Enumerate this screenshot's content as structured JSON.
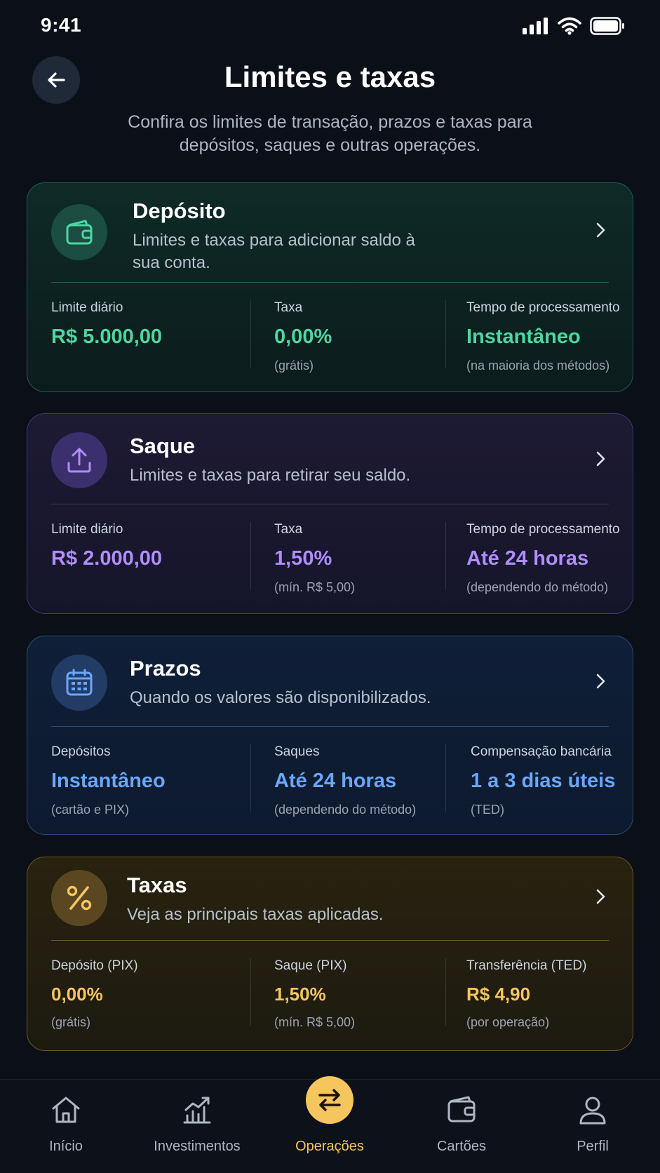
{
  "status_bar": {
    "time": "9:41"
  },
  "header": {
    "title": "Limites e taxas",
    "subtitle": "Confira os limites de transação, prazos e taxas para depósitos, saques e outras operações."
  },
  "colors": {
    "green": "#4ed6a0",
    "purple": "#b08cff",
    "blue": "#6aa6ff",
    "gold": "#f7c55d"
  },
  "cards": {
    "deposito": {
      "icon": "wallet-icon",
      "title": "Depósito",
      "description": "Limites e taxas para adicionar saldo à sua conta.",
      "stats": [
        {
          "label": "Limite diário",
          "value": "R$ 5.000,00",
          "note": ""
        },
        {
          "label": "Taxa",
          "value": "0,00%",
          "note": "(grátis)"
        },
        {
          "label": "Tempo de processamento",
          "value": "Instantâneo",
          "note": "(na maioria dos métodos)"
        }
      ]
    },
    "saque": {
      "icon": "upload-icon",
      "title": "Saque",
      "description": "Limites e taxas para retirar seu saldo.",
      "stats": [
        {
          "label": "Limite diário",
          "value": "R$ 2.000,00",
          "note": ""
        },
        {
          "label": "Taxa",
          "value": "1,50%",
          "note": "(mín. R$ 5,00)"
        },
        {
          "label": "Tempo de processamento",
          "value": "Até 24 horas",
          "note": "(dependendo do método)"
        }
      ]
    },
    "prazos": {
      "icon": "calendar-icon",
      "title": "Prazos",
      "description": "Quando os valores são disponibilizados.",
      "stats": [
        {
          "label": "Depósitos",
          "value": "Instantâneo",
          "note": "(cartão e PIX)"
        },
        {
          "label": "Saques",
          "value": "Até 24 horas",
          "note": "(dependendo do método)"
        },
        {
          "label": "Compensação bancária",
          "value": "1 a 3 dias úteis",
          "note": "(TED)"
        }
      ]
    },
    "taxas": {
      "icon": "percent-icon",
      "title": "Taxas",
      "description": "Veja as principais taxas aplicadas.",
      "stats": [
        {
          "label": "Depósito (PIX)",
          "value": "0,00%",
          "note": "(grátis)"
        },
        {
          "label": "Saque (PIX)",
          "value": "1,50%",
          "note": "(mín. R$ 5,00)"
        },
        {
          "label": "Transferência (TED)",
          "value": "R$ 4,90",
          "note": "(por operação)"
        }
      ]
    }
  },
  "nav": {
    "items": [
      {
        "label": "Início",
        "icon": "home-icon",
        "active": false
      },
      {
        "label": "Investimentos",
        "icon": "chart-icon",
        "active": false
      },
      {
        "label": "Operações",
        "icon": "swap-icon",
        "active": true
      },
      {
        "label": "Cartões",
        "icon": "wallet-icon",
        "active": false
      },
      {
        "label": "Perfil",
        "icon": "user-icon",
        "active": false
      }
    ]
  }
}
